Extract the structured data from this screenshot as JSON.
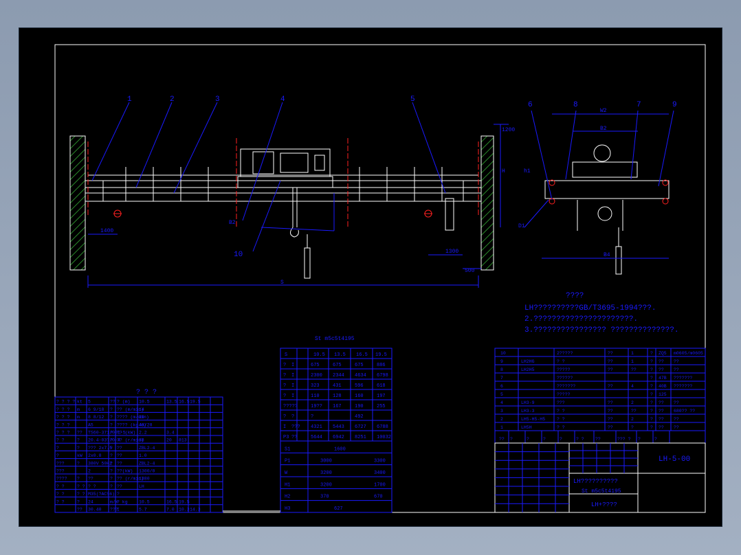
{
  "colors": {
    "background": "#000000",
    "frame": "#ffffff",
    "blue": "#1a1aff",
    "red": "#ff2020",
    "green": "#2a8a2a",
    "white": "#ffffff",
    "yellow": "#ffff00"
  },
  "callouts": [
    "1",
    "2",
    "3",
    "4",
    "5",
    "6",
    "8",
    "7",
    "9",
    "10"
  ],
  "dims": {
    "span": "S",
    "left_wheel": "1400",
    "right_wheel": "1300",
    "right_end": "500",
    "top_h": "1200",
    "height_h": "H",
    "side_a": "H1",
    "side_b": "H2",
    "side_c": "H3",
    "right_stack": [
      "2000",
      "1500",
      "1000"
    ],
    "b_dim": "B2",
    "b1_dim": "B1",
    "b3_dim": "B3",
    "w_top": "W2",
    "w_mid": "B2",
    "w_bottom": "B4",
    "h1_label": "h1",
    "h2_label": "h2",
    "d_label": "D1",
    "b_label": "B1"
  },
  "notes": {
    "title": "????",
    "lines": [
      "LH??????????GB/T3695-1994???.",
      "2.??????????????????????.",
      "3.???????????????? ??????????????."
    ]
  },
  "param_table": {
    "caption": "St  m5c5t4195",
    "header": [
      "S",
      "10.5",
      "13.5",
      "16.5",
      "19.5"
    ],
    "rows": [
      [
        "?",
        "I",
        "675",
        "675",
        "675",
        "886"
      ],
      [
        "?",
        "I",
        "2300",
        "2344",
        "4634",
        "6798"
      ],
      [
        "?",
        "I",
        "323",
        "431",
        "596",
        "618"
      ],
      [
        "?",
        "I",
        "110",
        "128",
        "160",
        "197"
      ],
      [
        "?????",
        "",
        "19??",
        "167",
        "190",
        "255"
      ],
      [
        "?",
        "?",
        "?",
        "",
        "492",
        "",
        ""
      ],
      [
        "I",
        "???",
        "4321",
        "5443",
        "6727",
        "6788"
      ],
      [
        "P3",
        "??",
        "5644",
        "6942",
        "8251",
        "10032"
      ]
    ],
    "rows2": [
      [
        "S1",
        "1600"
      ],
      [
        "P1",
        "3000",
        "3300"
      ],
      [
        "W",
        "3200",
        "3400"
      ],
      [
        "H1",
        "3200",
        "1700"
      ],
      [
        "H2",
        "370",
        "670"
      ],
      [
        "H3",
        "627"
      ]
    ]
  },
  "left_table": {
    "title": "? ? ?",
    "rows": [
      [
        "? ? ? ?",
        "kt",
        "5",
        "??",
        "? (m)",
        "10.5",
        "13.5",
        "16.5",
        "19.5"
      ],
      [
        "? ? ?",
        "m",
        "6  9/18",
        "?",
        "?? (m/min)",
        "14"
      ],
      [
        "? ? ?",
        "m",
        "8  8/12",
        "?",
        "???? (m/min)",
        "20"
      ],
      [
        "? ? ?",
        "",
        "A5",
        "?",
        "???? (kg/m)",
        "43/28"
      ],
      [
        "? ? ?",
        "??",
        "TS60-371/001-5",
        "?",
        "?? (kW)",
        "2.2",
        "3.4"
      ],
      [
        "? ?",
        "?",
        "20.4-03?/0-4",
        "?",
        "?? (r/min)",
        "38",
        "20",
        "813"
      ],
      [
        "?",
        "?",
        "??? 2x7.5",
        "?",
        "??",
        "ZBL2-4"
      ],
      [
        "?",
        "kW",
        "2x0.8",
        "?",
        "??",
        "1.0"
      ],
      [
        "???",
        "?",
        "380V 50HZ",
        "?",
        "??",
        "ZBL2-4"
      ],
      [
        "???",
        "",
        "2",
        "?",
        "??(kW)",
        "1300/0"
      ],
      [
        "????",
        "?",
        "??",
        "?",
        "?? (r/min)",
        "1380"
      ],
      [
        "? ?",
        "? ?",
        "? ?",
        "?",
        "??",
        "LH"
      ],
      [
        "? ?",
        "? ?",
        "M35(?ACS6)",
        "",
        "?"
      ],
      [
        "? ?",
        "?",
        "24",
        "m/m",
        "? kg",
        "10.5",
        "16.5",
        "19.5"
      ],
      [
        "",
        "??",
        "30.40",
        "???",
        "I",
        "5.7",
        "7.0",
        "10.3",
        "14.3"
      ]
    ]
  },
  "bom": {
    "rows": [
      [
        "10",
        "",
        "2?????",
        "??",
        "1",
        "?",
        "ZQ5",
        "m0605/m0605"
      ],
      [
        "9",
        "LH2HG",
        "? ?",
        "??",
        "1",
        "?",
        "??",
        "??"
      ],
      [
        "8",
        "LH2H5",
        "?????",
        "??",
        "??",
        "?",
        "??",
        "??"
      ],
      [
        "7",
        "",
        "??????",
        "",
        "",
        "?",
        "47B",
        "???????"
      ],
      [
        "6",
        "",
        "???????",
        "??",
        "4",
        "?",
        "40B",
        "???????"
      ],
      [
        "5",
        "",
        "?????",
        "",
        "",
        "?",
        "125",
        ""
      ],
      [
        "4",
        "LH3-9",
        "???",
        "??",
        "2",
        "?",
        "??",
        "??"
      ],
      [
        "3",
        "LH3-3",
        "? ?",
        "??",
        "??",
        "?",
        "??",
        "680?? ??"
      ],
      [
        "2",
        "LH5-H5-H5",
        "? ?",
        "??",
        "2",
        "?",
        "??",
        "??"
      ],
      [
        "1",
        "LH5H",
        "? ?",
        "??",
        "?",
        "?",
        "??",
        "??"
      ]
    ],
    "header": [
      "??",
      "?",
      "?",
      "?",
      "?",
      "? ?",
      "??",
      "??? ?",
      "?",
      "?"
    ]
  },
  "title_block": {
    "drawing_no": "LH-5-00",
    "name_line1": "LH??????????",
    "name_line2": "St  m5c5t4195",
    "name_line3": "LH+????",
    "small": [
      "??",
      "??",
      "??",
      "??",
      "??",
      "??",
      "??",
      "??",
      "??"
    ]
  }
}
